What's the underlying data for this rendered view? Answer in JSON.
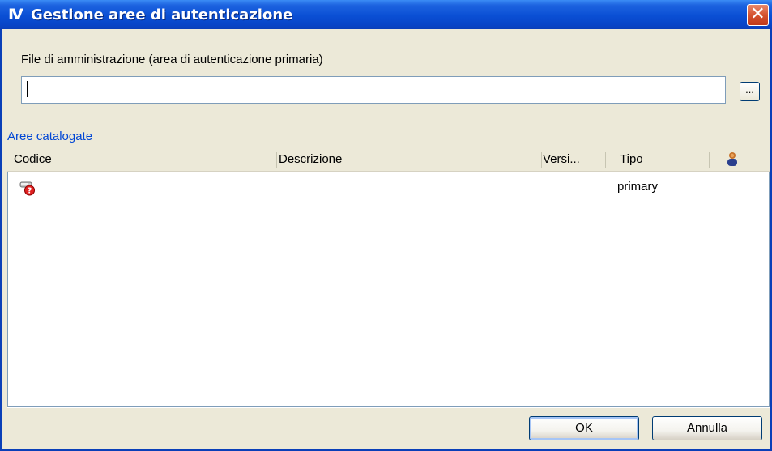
{
  "window": {
    "app_icon_text": "IV",
    "title": "Gestione aree di autenticazione",
    "close_label": "✕"
  },
  "file_section": {
    "label": "File di amministrazione (area di autenticazione primaria)",
    "input_value": "",
    "browse_label": "..."
  },
  "areas_group": {
    "title": "Aree catalogate",
    "columns": [
      "Codice",
      "Descrizione",
      "Versi...",
      "Tipo"
    ],
    "user_column_icon": "user-icon",
    "rows": [
      {
        "icon": "key-question-icon",
        "codice": "",
        "descrizione": "",
        "versione": "",
        "tipo": "primary"
      }
    ]
  },
  "buttons": {
    "ok": "OK",
    "cancel": "Annulla"
  },
  "colors": {
    "titlebar": "#0A4FD4",
    "dialog_bg": "#ECE9D8",
    "group_title": "#0046D5",
    "close_button": "#D5532F"
  }
}
